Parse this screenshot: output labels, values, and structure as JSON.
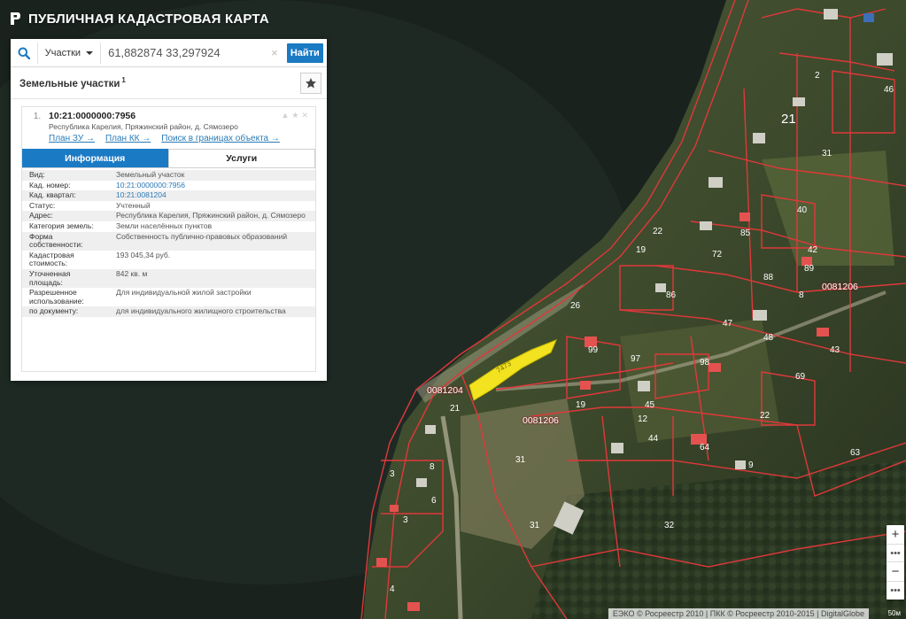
{
  "app": {
    "title": "ПУБЛИЧНАЯ КАДАСТРОВАЯ КАРТА"
  },
  "search": {
    "type_label": "Участки",
    "query": "61,882874 33,297924",
    "clear_icon": "×",
    "find_label": "Найти"
  },
  "results": {
    "title": "Земельные участки",
    "count": "1"
  },
  "item": {
    "number": "1.",
    "cadastral_id": "10:21:0000000:7956",
    "address_short": "Республика Карелия, Пряжинский район, д. Сямозеро",
    "links": [
      "План ЗУ →",
      "План КК →",
      "Поиск в границах объекта →"
    ],
    "tabs": [
      "Информация",
      "Услуги"
    ],
    "info": [
      {
        "k": "Вид:",
        "v": "Земельный участок"
      },
      {
        "k": "Кад. номер:",
        "v": "10:21:0000000:7956"
      },
      {
        "k": "Кад. квартал:",
        "v": "10:21:0081204"
      },
      {
        "k": "Статус:",
        "v": "Учтенный"
      },
      {
        "k": "Адрес:",
        "v": "Республика Карелия, Пряжинский район, д. Сямозеро"
      },
      {
        "k": "Категория земель:",
        "v": "Земли населённых пунктов"
      },
      {
        "k": "Форма собственности:",
        "v": "Собственность публично-правовых образований"
      },
      {
        "k": "Кадастровая стоимость:",
        "v": "193 045,34 руб."
      },
      {
        "k": "Уточненная площадь:",
        "v": "842 кв. м"
      },
      {
        "k": "Разрешенное использование:",
        "v": "Для индивидуальной жилой застройки"
      },
      {
        "k": "по документу:",
        "v": "для индивидуального жилищного строительства"
      }
    ]
  },
  "map": {
    "quarters": [
      "0081206",
      "0081204",
      "0081206"
    ],
    "block_label": "21",
    "parcel_numbers": [
      "46",
      "2",
      "31",
      "40",
      "42",
      "43",
      "89",
      "8",
      "88",
      "72",
      "85",
      "19",
      "22",
      "26",
      "86",
      "47",
      "48",
      "99",
      "97",
      "98",
      "69",
      "45",
      "12",
      "44",
      "64",
      "9",
      "3",
      "21",
      "8",
      "19",
      "31",
      "32",
      "31",
      "6",
      "3",
      "4",
      "22",
      "63",
      "7473"
    ],
    "controls": {
      "zoom_in": "+",
      "zoom_out": "−",
      "more": "•••"
    },
    "copyright": "ЕЭКО © Росреестр 2010 | ПКК © Росреестр 2010-2015 | DigitalGlobe",
    "scale": "50м"
  },
  "colors": {
    "accent": "#1b7ac4",
    "parcel_border": "#e0383a",
    "highlight": "#f2e21f"
  }
}
